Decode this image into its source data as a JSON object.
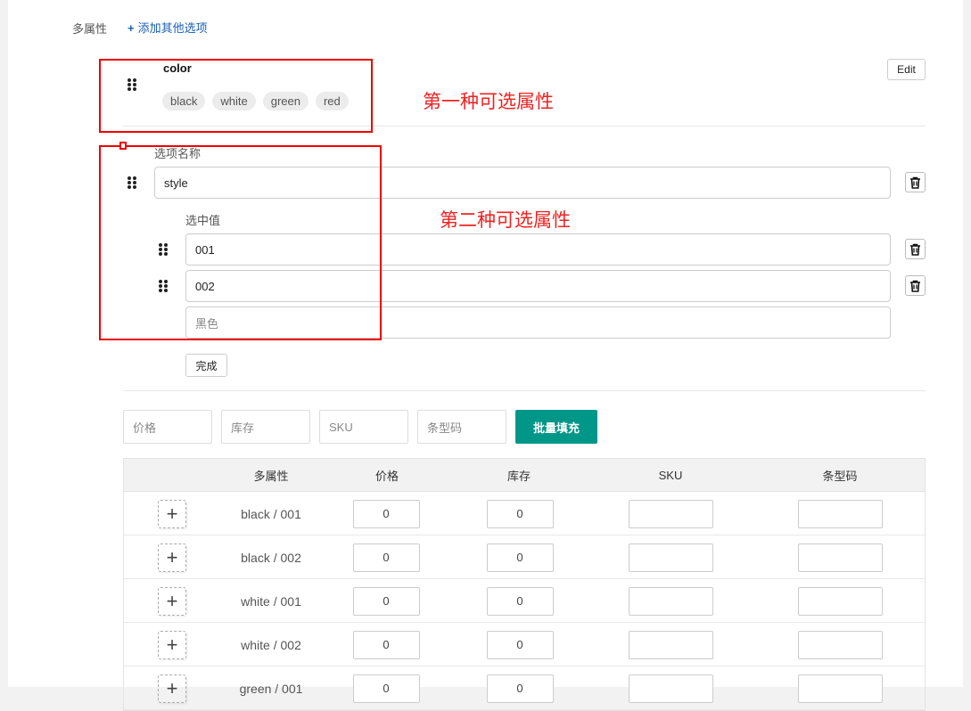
{
  "header": {
    "label": "多属性",
    "add_option": "添加其他选项"
  },
  "option1": {
    "name": "color",
    "values": [
      "black",
      "white",
      "green",
      "red"
    ],
    "edit_label": "Edit"
  },
  "option2": {
    "name_label": "选项名称",
    "name_value": "style",
    "values_label": "选中值",
    "values": [
      "001",
      "002"
    ],
    "new_value_placeholder": "黑色",
    "done_label": "完成"
  },
  "annotations": {
    "first": "第一种可选属性",
    "second": "第二种可选属性"
  },
  "batch": {
    "price_ph": "价格",
    "stock_ph": "库存",
    "sku_ph": "SKU",
    "barcode_ph": "条型码",
    "button": "批量填充"
  },
  "table": {
    "headers": [
      "多属性",
      "价格",
      "库存",
      "SKU",
      "条型码"
    ],
    "rows": [
      {
        "variant": "black / 001",
        "price": "0",
        "stock": "0",
        "sku": "",
        "barcode": ""
      },
      {
        "variant": "black / 002",
        "price": "0",
        "stock": "0",
        "sku": "",
        "barcode": ""
      },
      {
        "variant": "white / 001",
        "price": "0",
        "stock": "0",
        "sku": "",
        "barcode": ""
      },
      {
        "variant": "white / 002",
        "price": "0",
        "stock": "0",
        "sku": "",
        "barcode": ""
      },
      {
        "variant": "green / 001",
        "price": "0",
        "stock": "0",
        "sku": "",
        "barcode": ""
      }
    ]
  },
  "colors": {
    "accent": "#009688",
    "link": "#1a5fb4",
    "annotation": "#ee2222"
  }
}
